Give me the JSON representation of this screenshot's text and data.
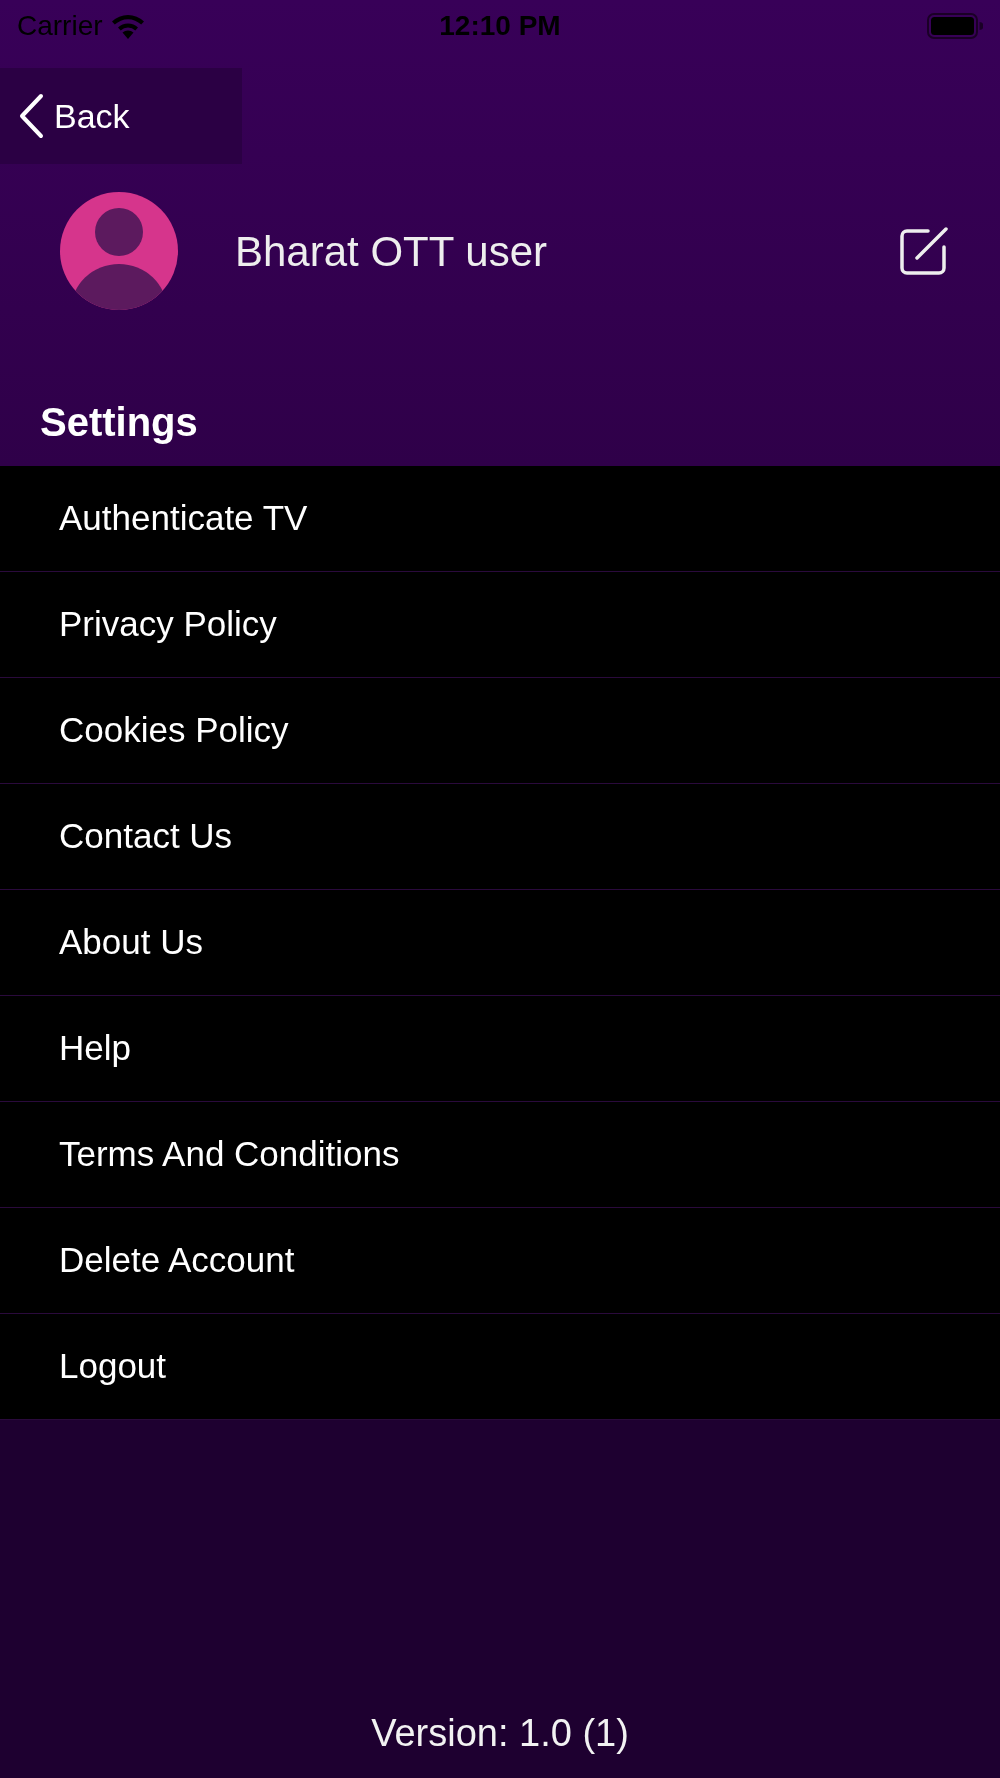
{
  "status_bar": {
    "carrier": "Carrier",
    "time": "12:10 PM"
  },
  "nav": {
    "back_label": "Back"
  },
  "profile": {
    "name": "Bharat OTT user"
  },
  "settings": {
    "title": "Settings",
    "items": [
      "Authenticate TV",
      "Privacy Policy",
      "Cookies Policy",
      "Contact Us",
      "About Us",
      "Help",
      "Terms And Conditions",
      "Delete Account",
      "Logout"
    ]
  },
  "footer": {
    "version": "Version: 1.0 (1)"
  }
}
